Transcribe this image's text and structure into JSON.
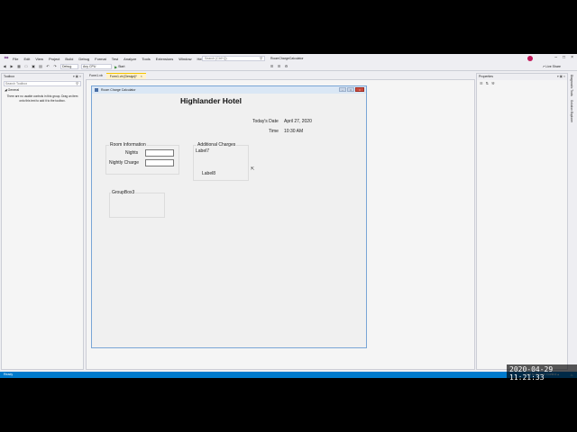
{
  "menubar": {
    "items": [
      "File",
      "Edit",
      "View",
      "Project",
      "Build",
      "Debug",
      "Format",
      "Test",
      "Analyze",
      "Tools",
      "Extensions",
      "Window",
      "Help"
    ],
    "search_placeholder": "Search (Ctrl+Q)",
    "solution_name": "RoomChargeCalculator"
  },
  "toolbar": {
    "config": "Debug",
    "platform": "Any CPU",
    "start_label": "Start",
    "live_share": "Live Share"
  },
  "toolbox": {
    "title": "Toolbox",
    "search_placeholder": "Search Toolbox",
    "group": "◢ General",
    "message": "There are no usable controls in this group. Drag an item onto this text to add it to the toolbox."
  },
  "tabs": [
    {
      "label": "Form1.vb"
    },
    {
      "label": "Form1.vb [Design]*"
    }
  ],
  "form": {
    "title": "Room Charge Calculator",
    "hotel_title": "Highlander Hotel",
    "todays_date_label": "Today's Date",
    "todays_date_value": "April 27, 2020",
    "time_label": "Time",
    "time_value": "10:30 AM",
    "room_info_title": "Room Information",
    "nights_label": "Nights",
    "nightly_charge_label": "Nightly Charge",
    "additional_charges_title": "Additional Charges",
    "label7": "Label7",
    "label8": "Label8",
    "groupbox3_title": "GroupBox3"
  },
  "properties": {
    "title": "Properties"
  },
  "right_tabs": [
    "Diagnostic Tools",
    "Solution Explorer"
  ],
  "status": {
    "left": "Ready",
    "right": "↑ Add to Source Control ▴"
  },
  "timestamp": "2020-04-29 11:21:33",
  "colors": {
    "accent": "#007acc",
    "vs_purple": "#68217a",
    "active_tab": "#fff2cc"
  }
}
